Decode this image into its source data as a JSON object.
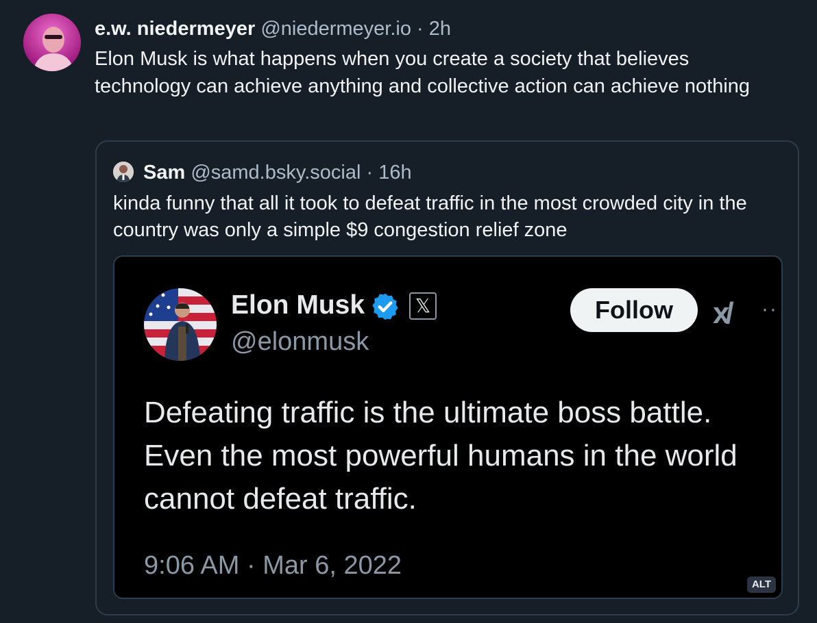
{
  "post": {
    "author_name": "e.w. niedermeyer",
    "author_handle": "@niedermeyer.io",
    "separator": "·",
    "time": "2h",
    "text": "Elon Musk is what happens when you create a society that believes technology can achieve anything and collective action can achieve nothing"
  },
  "quote": {
    "author_name": "Sam",
    "author_handle": "@samd.bsky.social",
    "separator": "·",
    "time": "16h",
    "text": "kinda funny that all it took to defeat traffic in the most crowded city in the country was only a simple $9 congestion relief zone"
  },
  "embedded_tweet": {
    "name": "Elon Musk",
    "handle": "@elonmusk",
    "x_badge": "𝕏",
    "follow_label": "Follow",
    "xai_logo": "x/",
    "more_label": "··",
    "text": "Defeating traffic is the ultimate boss battle. Even the most powerful humans in the world cannot defeat traffic.",
    "timestamp": "9:06 AM · Mar 6, 2022",
    "alt_label": "ALT"
  },
  "icons": {
    "avatar_main": "avatar",
    "avatar_quote": "avatar",
    "avatar_x": "avatar",
    "verified": "verified-badge-icon",
    "more": "more-icon"
  },
  "colors": {
    "background": "#161e27",
    "card_border": "#2e3c4b",
    "text_primary": "#f1f3f5",
    "text_secondary": "#aebbc9",
    "embed_background": "#000000",
    "verified_blue": "#1d9bf0"
  }
}
